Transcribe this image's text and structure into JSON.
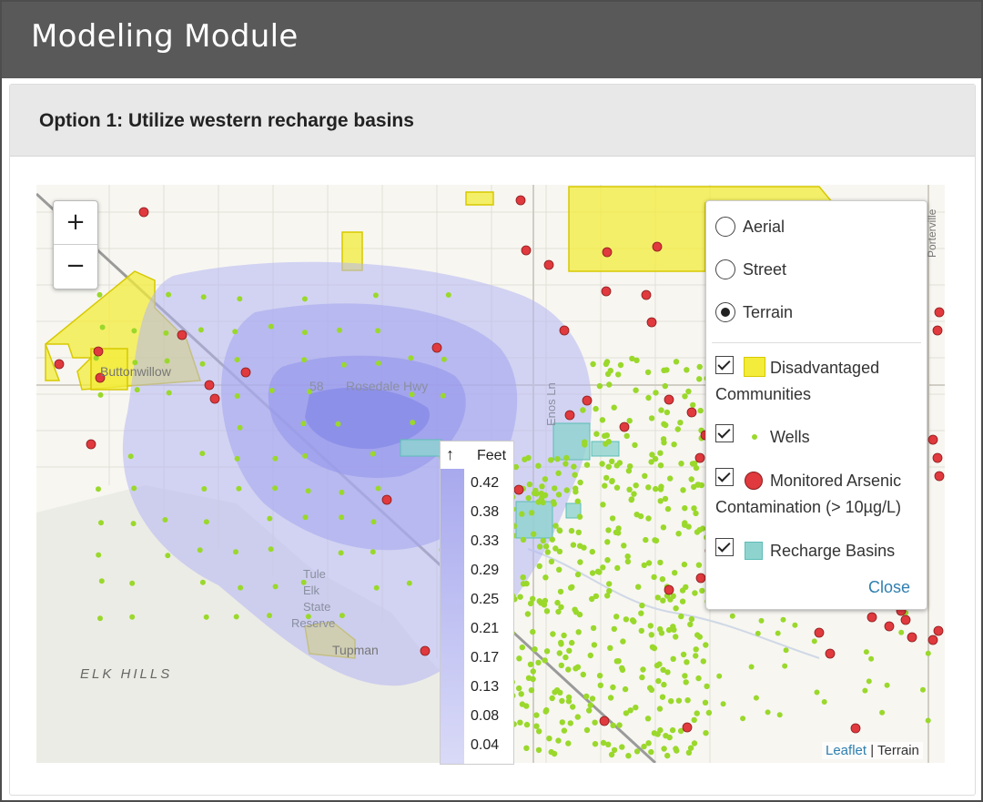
{
  "header": {
    "title": "Modeling Module"
  },
  "panel": {
    "heading": "Option 1: Utilize western recharge basins"
  },
  "map": {
    "zoom_in": "+",
    "zoom_out": "−",
    "labels": {
      "town_buttonwillow": "Buttonwillow",
      "road_rosedale": "Rosedale Hwy",
      "route_58": "58",
      "tule_elk": [
        "Tule",
        "Elk",
        "State",
        "Reserve"
      ],
      "tupman": "Tupman",
      "elk_hills": "ELK HILLS",
      "road_enos": "Enos Ln",
      "road_porterville": "Porterville"
    },
    "colors": {
      "plume": "#8f91ea",
      "wells": "#9ad82b",
      "arsenic": "#e0393e",
      "disadvantaged": "#f3ec3a",
      "recharge": "#8fd3cf"
    }
  },
  "legend": {
    "arrow": "↑",
    "unit": "Feet",
    "values": [
      "0.42",
      "0.38",
      "0.33",
      "0.29",
      "0.25",
      "0.21",
      "0.17",
      "0.13",
      "0.08",
      "0.04"
    ]
  },
  "layers": {
    "base": [
      {
        "label": "Aerial",
        "selected": false
      },
      {
        "label": "Street",
        "selected": false
      },
      {
        "label": "Terrain",
        "selected": true
      }
    ],
    "overlays": {
      "disadvantaged_1": "Disadvantaged",
      "disadvantaged_2": "Communities",
      "wells": "Wells",
      "arsenic_1": "Monitored Arsenic",
      "arsenic_2": "Contamination (> 10µg/L)",
      "recharge": "Recharge Basins"
    },
    "close": "Close"
  },
  "attribution": {
    "link": "Leaflet",
    "sep": " | ",
    "text": "Terrain"
  }
}
